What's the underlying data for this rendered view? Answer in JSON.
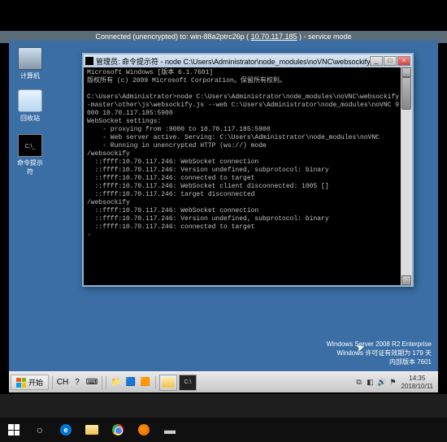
{
  "vnc_banner": {
    "prefix": "Connected (unencrypted) to: ",
    "host": "win-88a2ptrc26p",
    "ip": "10.70.117.185",
    "suffix": " - service mode"
  },
  "desktop_icons": {
    "computer": "计算机",
    "recycle": "回收站",
    "cmd_shortcut": "命令提示符"
  },
  "cmd_window": {
    "title": "管理员: 命令提示符 - node  C:\\Users\\Administrator\\node_modules\\noVNC\\websockify-m...",
    "lines": [
      "Microsoft Windows [版本 6.1.7601]",
      "版权所有 (c) 2009 Microsoft Corporation。保留所有权利。",
      "",
      "C:\\Users\\Administrator>node C:\\Users\\Administrator\\node_modules\\noVNC\\websockify",
      "-master\\other\\js\\websockify.js --web C:\\Users\\Administrator\\node_modules\\noVNC 9",
      "000 10.70.117.185:5900",
      "WebSocket settings:",
      "    - proxying from :9000 to 10.70.117.185:5900",
      "    - Web server active. Serving: C:\\Users\\Administrator\\node_modules\\noVNC",
      "    - Running in unencrypted HTTP (ws://) mode",
      "/websockify",
      "  ::ffff:10.70.117.246: WebSocket connection",
      "  ::ffff:10.70.117.246: Version undefined, subprotocol: binary",
      "  ::ffff:10.70.117.246: connected to target",
      "  ::ffff:10.70.117.246: WebSocket client disconnected: 1005 []",
      "  ::ffff:10.70.117.246: target disconnected",
      "/websockify",
      "  ::ffff:10.70.117.246: WebSocket connection",
      "  ::ffff:10.70.117.246: Version undefined, subprotocol: binary",
      "  ::ffff:10.70.117.246: connected to target",
      "-"
    ]
  },
  "branding": {
    "line1": "Windows Server 2008 R2 Enterprise",
    "line2": "Windows 许可证有效期为 179 天",
    "line3": "内部版本 7601"
  },
  "taskbar": {
    "start": "开始",
    "lang": "CH",
    "clock_time": "14:35",
    "clock_date": "2018/10/11"
  }
}
